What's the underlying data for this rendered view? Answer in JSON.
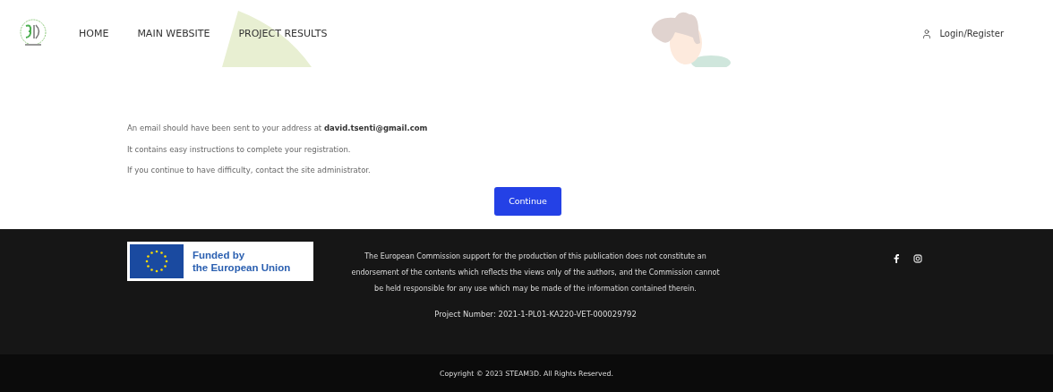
{
  "header": {
    "nav": [
      {
        "label": "HOME"
      },
      {
        "label": "MAIN WEBSITE"
      },
      {
        "label": "PROJECT RESULTS"
      }
    ],
    "login": "Login/Register"
  },
  "message": {
    "lines": [
      "An email should have been sent to your address at **david.tsenti@gmail.com**",
      "It contains easy instructions to complete your registration.",
      "If you continue to have difficulty, contact the site administrator."
    ],
    "button": "Continue"
  },
  "footer": {
    "eu_badge": "Funded by\nthe European Union",
    "disclaimer": "The European Commission support for the production of this publication does not constitute an endorsement of the contents which reflects the views only of the authors, and the Commission cannot be held responsible for any use which may be made of the information contained therein.",
    "project_number": "Project Number: 2021-1-PL01-KA220-VET-000029792",
    "copyright": "Copyright © 2023 STEAM3D. All Rights Reserved."
  }
}
